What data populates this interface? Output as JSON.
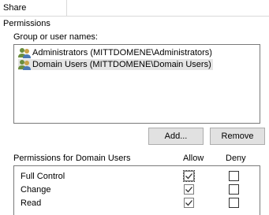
{
  "tab": {
    "label": "Share Permissions"
  },
  "groups": {
    "label": "Group or user names:",
    "items": [
      {
        "name": "Administrators (MITTDOMENE\\Administrators)",
        "selected": false,
        "icon": "user-group-icon"
      },
      {
        "name": "Domain Users (MITTDOMENE\\Domain Users)",
        "selected": true,
        "icon": "user-group-icon"
      }
    ]
  },
  "buttons": {
    "add": "Add...",
    "remove": "Remove"
  },
  "permissions": {
    "title": "Permissions for Domain Users",
    "allow_label": "Allow",
    "deny_label": "Deny",
    "rows": [
      {
        "name": "Full Control",
        "allow": true,
        "deny": false
      },
      {
        "name": "Change",
        "allow": true,
        "deny": false
      },
      {
        "name": "Read",
        "allow": true,
        "deny": false
      }
    ]
  },
  "colors": {
    "selection": "#e5e5e5",
    "button_bg": "#e1e1e1",
    "border": "#7a7a7a"
  }
}
